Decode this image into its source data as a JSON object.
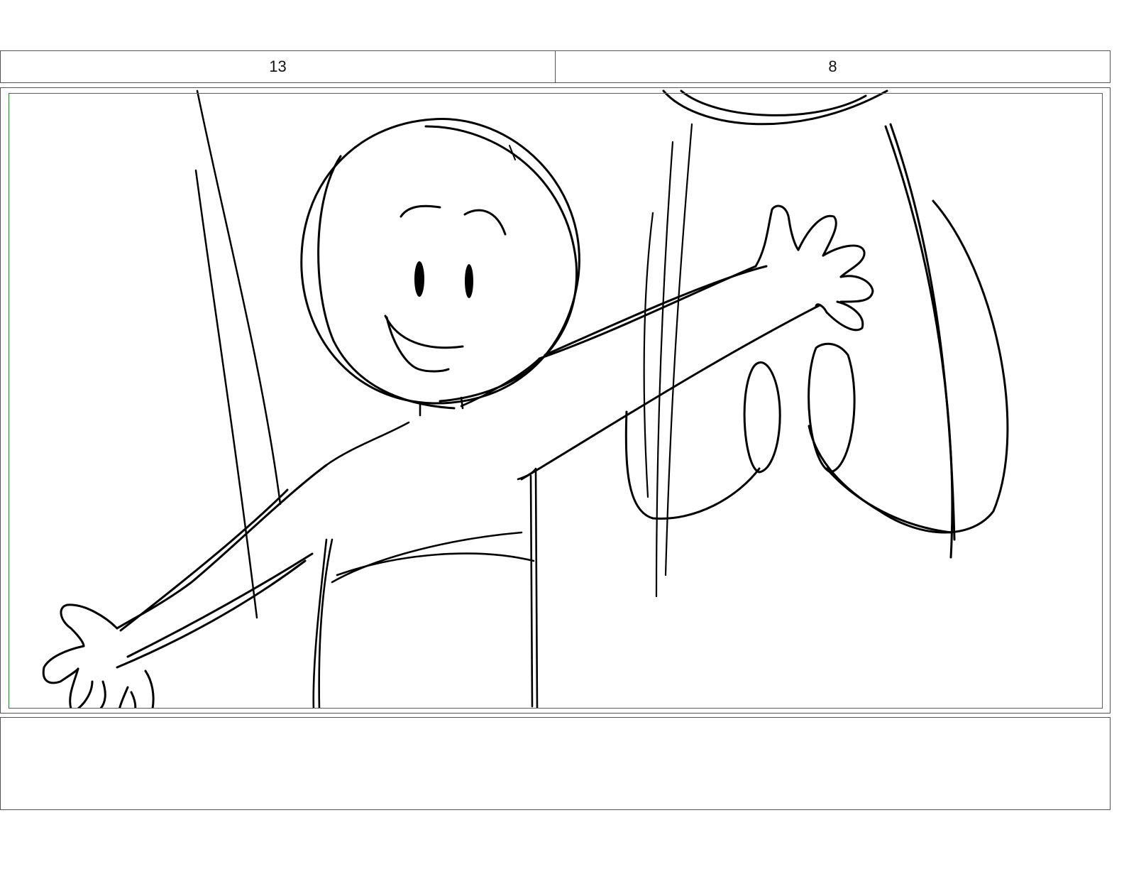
{
  "header": {
    "panel_number": "13",
    "duration": "8"
  },
  "panel": {
    "image_description_icon": "storyboard-sketch-character-waving",
    "safe_area_color": "#2e7d32"
  },
  "notes": {
    "text": ""
  }
}
